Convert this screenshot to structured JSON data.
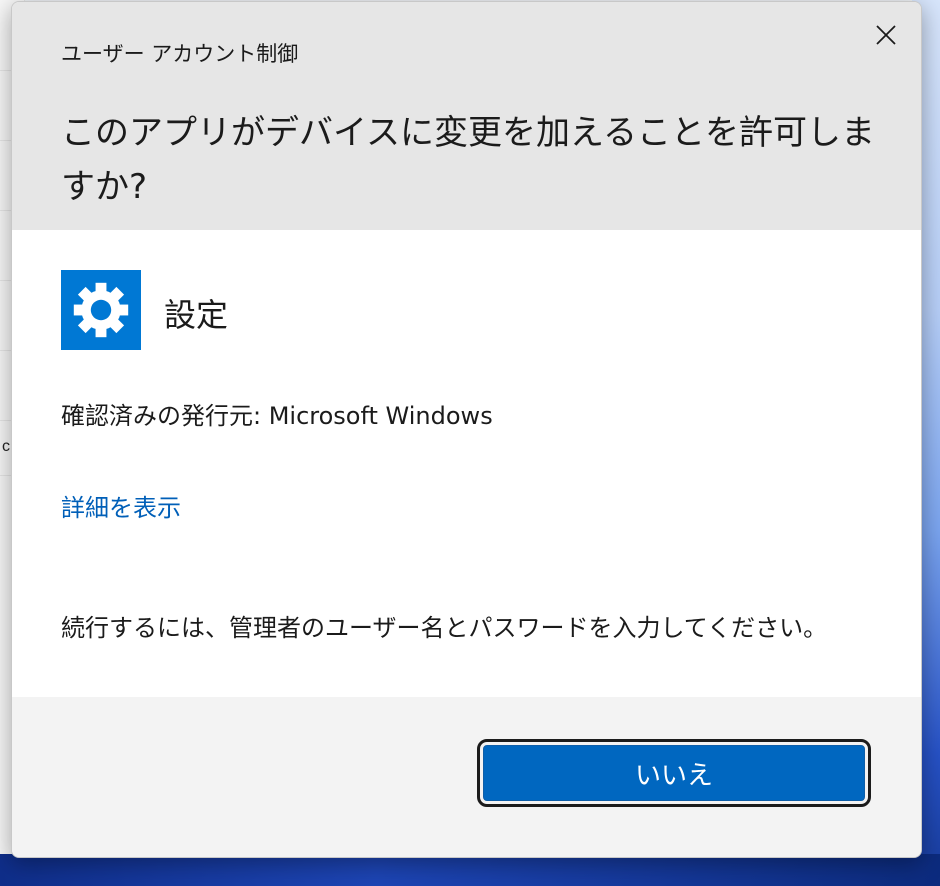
{
  "dialog": {
    "caption": "ユーザー アカウント制御",
    "question": "このアプリがデバイスに変更を加えることを許可しますか?",
    "app_icon": "gear-icon",
    "app_name": "設定",
    "publisher": "確認済みの発行元: Microsoft Windows",
    "details_link": "詳細を表示",
    "instruction": "続行するには、管理者のユーザー名とパスワードを入力してください。",
    "no_button": "いいえ"
  },
  "background": {
    "left_partial_char": "c"
  },
  "colors": {
    "accent": "#0067c0",
    "icon_tile": "#0078d4",
    "link": "#005fb8"
  }
}
